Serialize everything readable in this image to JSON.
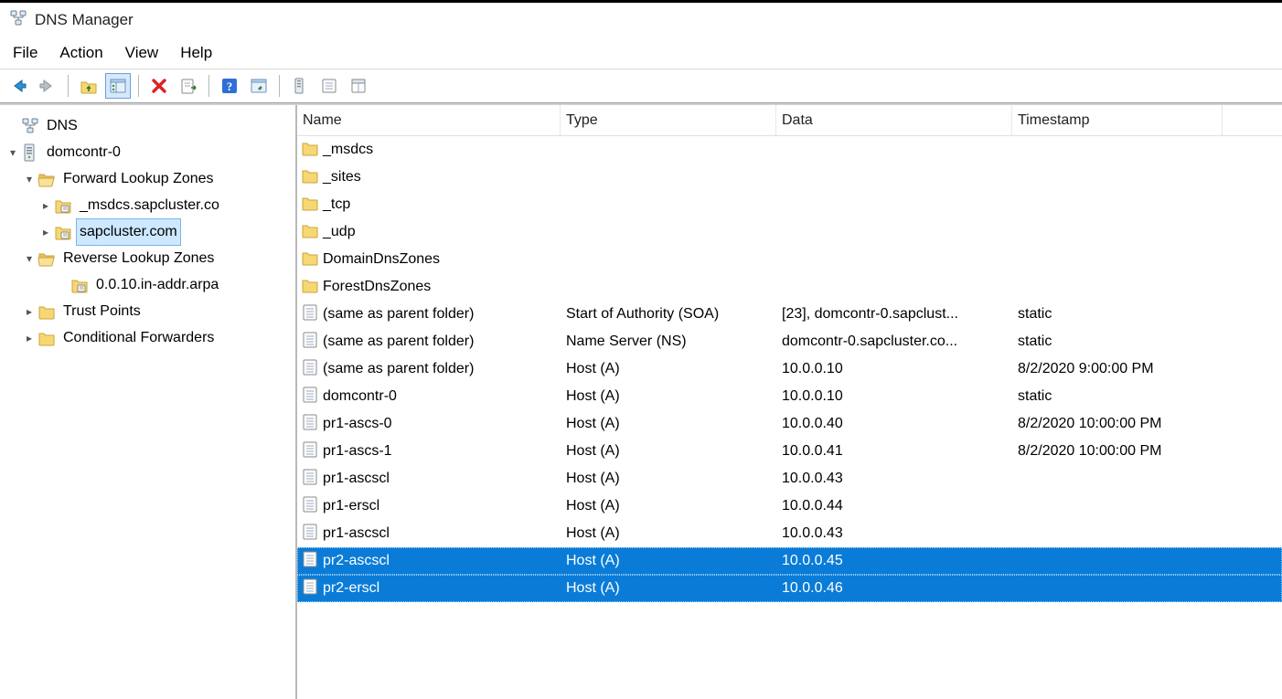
{
  "window": {
    "title": "DNS Manager"
  },
  "menubar": {
    "file": "File",
    "action": "Action",
    "view": "View",
    "help": "Help"
  },
  "toolbar": {
    "back": "back",
    "forward": "forward",
    "up_folder": "up-folder",
    "show_hide": "show-hide-console-tree",
    "delete": "delete",
    "export": "export-list",
    "help": "help",
    "properties": "properties",
    "refresh_server": "refresh-server",
    "new_record": "new-record",
    "filter": "filter"
  },
  "tree": {
    "root": "DNS",
    "server": "domcontr-0",
    "flz_label": "Forward Lookup Zones",
    "flz_children": [
      {
        "label": "_msdcs.sapcluster.co",
        "selected": false
      },
      {
        "label": "sapcluster.com",
        "selected": true
      }
    ],
    "rlz_label": "Reverse Lookup Zones",
    "rlz_children": [
      {
        "label": "0.0.10.in-addr.arpa"
      }
    ],
    "trust_points": "Trust Points",
    "cond_fwd": "Conditional Forwarders"
  },
  "columns": {
    "name": "Name",
    "type": "Type",
    "data": "Data",
    "timestamp": "Timestamp"
  },
  "records": [
    {
      "icon": "folder",
      "name": "_msdcs",
      "type": "",
      "data": "",
      "ts": "",
      "selected": false
    },
    {
      "icon": "folder",
      "name": "_sites",
      "type": "",
      "data": "",
      "ts": "",
      "selected": false
    },
    {
      "icon": "folder",
      "name": "_tcp",
      "type": "",
      "data": "",
      "ts": "",
      "selected": false
    },
    {
      "icon": "folder",
      "name": "_udp",
      "type": "",
      "data": "",
      "ts": "",
      "selected": false
    },
    {
      "icon": "folder",
      "name": "DomainDnsZones",
      "type": "",
      "data": "",
      "ts": "",
      "selected": false
    },
    {
      "icon": "folder",
      "name": "ForestDnsZones",
      "type": "",
      "data": "",
      "ts": "",
      "selected": false
    },
    {
      "icon": "record",
      "name": "(same as parent folder)",
      "type": "Start of Authority (SOA)",
      "data": "[23], domcontr-0.sapclust...",
      "ts": "static",
      "selected": false
    },
    {
      "icon": "record",
      "name": "(same as parent folder)",
      "type": "Name Server (NS)",
      "data": "domcontr-0.sapcluster.co...",
      "ts": "static",
      "selected": false
    },
    {
      "icon": "record",
      "name": "(same as parent folder)",
      "type": "Host (A)",
      "data": "10.0.0.10",
      "ts": "8/2/2020 9:00:00 PM",
      "selected": false
    },
    {
      "icon": "record",
      "name": "domcontr-0",
      "type": "Host (A)",
      "data": "10.0.0.10",
      "ts": "static",
      "selected": false
    },
    {
      "icon": "record",
      "name": "pr1-ascs-0",
      "type": "Host (A)",
      "data": "10.0.0.40",
      "ts": "8/2/2020 10:00:00 PM",
      "selected": false
    },
    {
      "icon": "record",
      "name": "pr1-ascs-1",
      "type": "Host (A)",
      "data": "10.0.0.41",
      "ts": "8/2/2020 10:00:00 PM",
      "selected": false
    },
    {
      "icon": "record",
      "name": "pr1-ascscl",
      "type": "Host (A)",
      "data": "10.0.0.43",
      "ts": "",
      "selected": false
    },
    {
      "icon": "record",
      "name": "pr1-erscl",
      "type": "Host (A)",
      "data": "10.0.0.44",
      "ts": "",
      "selected": false
    },
    {
      "icon": "record",
      "name": "pr1-ascscl",
      "type": "Host (A)",
      "data": "10.0.0.43",
      "ts": "",
      "selected": false
    },
    {
      "icon": "record",
      "name": "pr2-ascscl",
      "type": "Host (A)",
      "data": "10.0.0.45",
      "ts": "",
      "selected": true
    },
    {
      "icon": "record",
      "name": "pr2-erscl",
      "type": "Host (A)",
      "data": "10.0.0.46",
      "ts": "",
      "selected": true
    }
  ]
}
